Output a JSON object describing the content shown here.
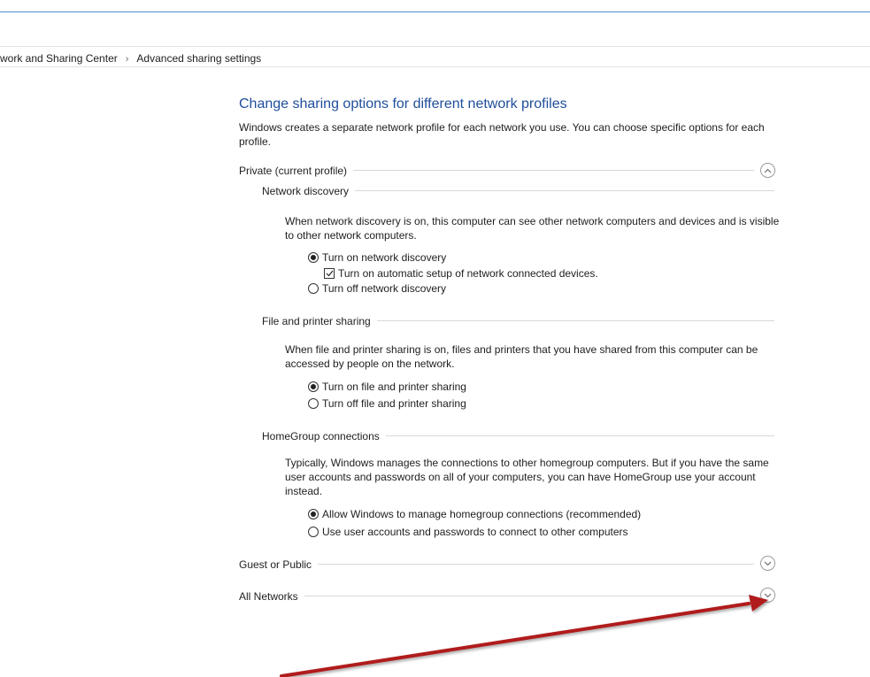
{
  "breadcrumb": {
    "items": [
      "work and Sharing Center",
      "Advanced sharing settings"
    ],
    "separator": "›"
  },
  "main": {
    "title": "Change sharing options for different network profiles",
    "description": "Windows creates a separate network profile for each network you use. You can choose specific options for each profile."
  },
  "profiles": {
    "private": {
      "label": "Private (current profile)",
      "chevron": "chevron-up-icon",
      "sections": {
        "network_discovery": {
          "label": "Network discovery",
          "description": "When network discovery is on, this computer can see other network computers and devices and is visible to other network computers.",
          "options": {
            "on": "Turn on network discovery",
            "auto_setup": "Turn on automatic setup of network connected devices.",
            "off": "Turn off network discovery"
          },
          "selected": "on",
          "auto_setup_checked": true
        },
        "file_printer": {
          "label": "File and printer sharing",
          "description": "When file and printer sharing is on, files and printers that you have shared from this computer can be accessed by people on the network.",
          "options": {
            "on": "Turn on file and printer sharing",
            "off": "Turn off file and printer sharing"
          },
          "selected": "on"
        },
        "homegroup": {
          "label": "HomeGroup connections",
          "description": "Typically, Windows manages the connections to other homegroup computers. But if you have the same user accounts and passwords on all of your computers, you can have HomeGroup use your account instead.",
          "options": {
            "allow": "Allow Windows to manage homegroup connections (recommended)",
            "user": "Use user accounts and passwords to connect to other computers"
          },
          "selected": "allow"
        }
      }
    },
    "guest": {
      "label": "Guest or Public",
      "chevron": "chevron-down-icon"
    },
    "all": {
      "label": "All Networks",
      "chevron": "chevron-down-icon"
    }
  },
  "annotation": {
    "arrow_color": "#b01c1c"
  },
  "colors": {
    "title": "#1f4e9c",
    "top_rule": "#4a90d0",
    "divider": "#d8d8d8"
  }
}
